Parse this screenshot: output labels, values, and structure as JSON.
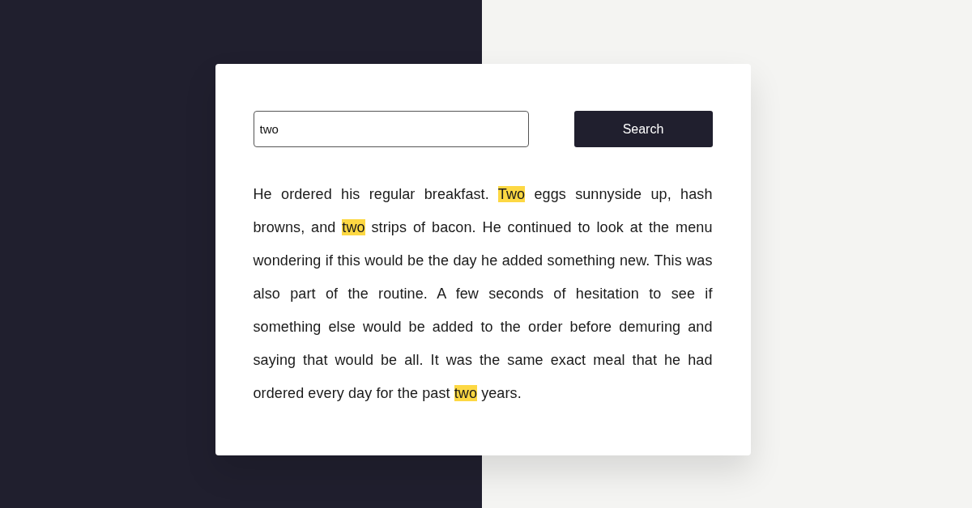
{
  "search": {
    "value": "two",
    "button": "Search"
  },
  "paragraph": [
    {
      "text": "He ordered his regular breakfast. ",
      "highlighted": false
    },
    {
      "text": "Two",
      "highlighted": true
    },
    {
      "text": " eggs sunnyside up, hash browns, and ",
      "highlighted": false
    },
    {
      "text": "two",
      "highlighted": true
    },
    {
      "text": " strips of bacon. He continued to look at the menu wondering if this would be the day he added something new. This was also part of the routine. A few seconds of hesitation to see if something else would be added to the order before demuring and saying that would be all. It was the same exact meal that he had ordered every day for the past ",
      "highlighted": false
    },
    {
      "text": "two",
      "highlighted": true
    },
    {
      "text": " years.",
      "highlighted": false
    }
  ]
}
